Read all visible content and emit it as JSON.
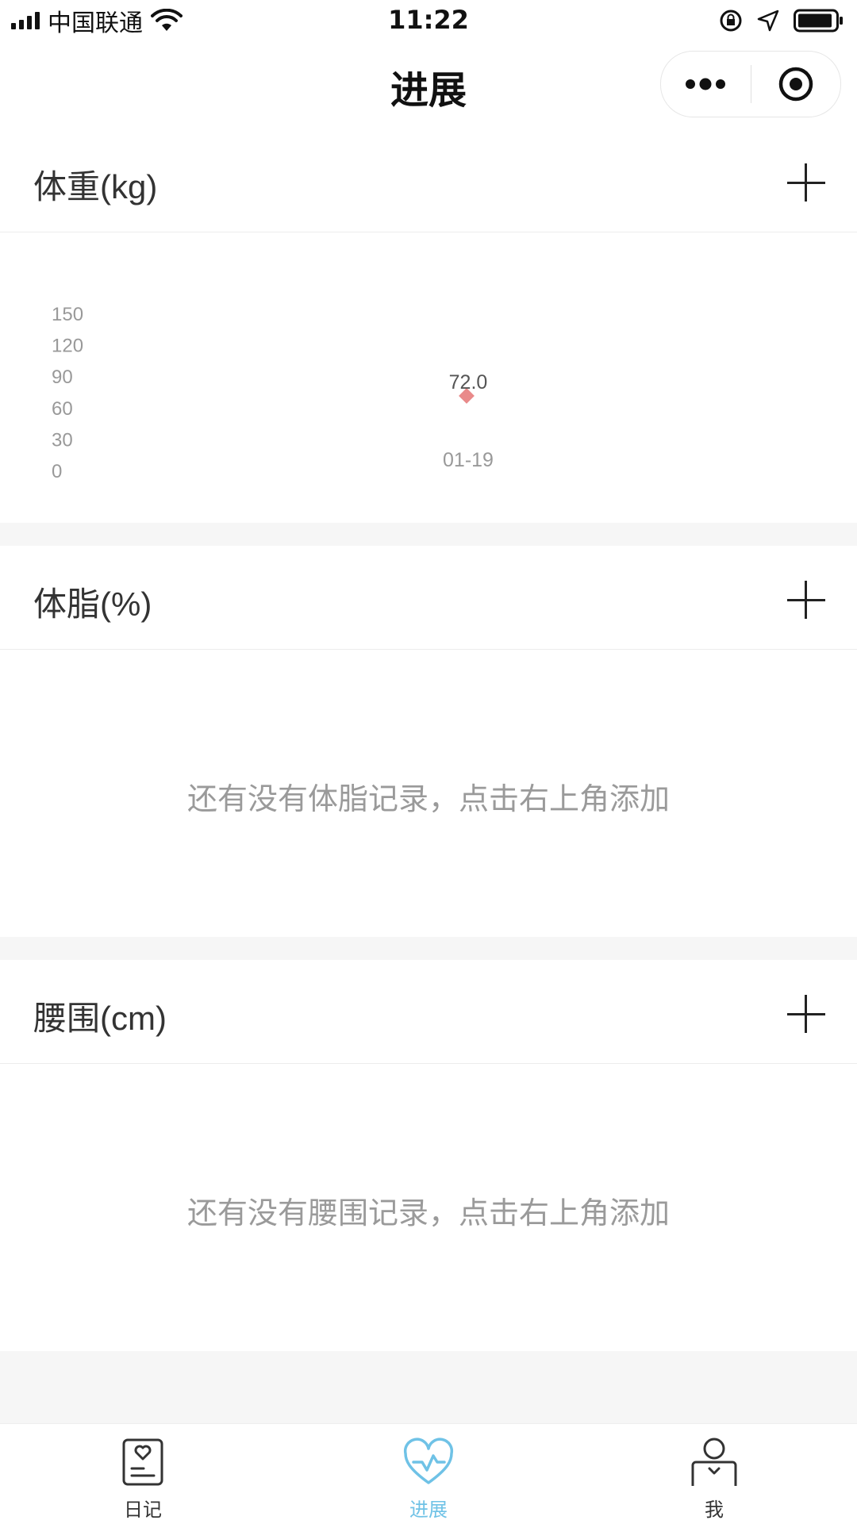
{
  "status_bar": {
    "carrier": "中国联通",
    "time": "11:22"
  },
  "nav": {
    "title": "进展"
  },
  "weight": {
    "title": "体重(kg)",
    "chart_data": {
      "type": "scatter",
      "x": [
        "01-19"
      ],
      "series": [
        {
          "values": [
            72.0
          ]
        }
      ],
      "data_labels": [
        "72.0"
      ],
      "y_ticks": [
        "150",
        "120",
        "90",
        "60",
        "30",
        "0"
      ],
      "ylim": [
        0,
        150
      ],
      "grid": false,
      "color": "#e98a8a"
    }
  },
  "body_fat": {
    "title": "体脂(%)",
    "empty_text": "还有没有体脂记录，点击右上角添加"
  },
  "waist": {
    "title": "腰围(cm)",
    "empty_text": "还有没有腰围记录，点击右上角添加"
  },
  "tabs": [
    {
      "label": "日记",
      "icon": "diary-icon",
      "active": false
    },
    {
      "label": "进展",
      "icon": "heart-pulse-icon",
      "active": true
    },
    {
      "label": "我",
      "icon": "user-icon",
      "active": false
    }
  ],
  "colors": {
    "accent": "#6fc2e6",
    "marker": "#e98a8a",
    "placeholder": "#9a9a9a",
    "section_gap": "#f6f6f6"
  }
}
